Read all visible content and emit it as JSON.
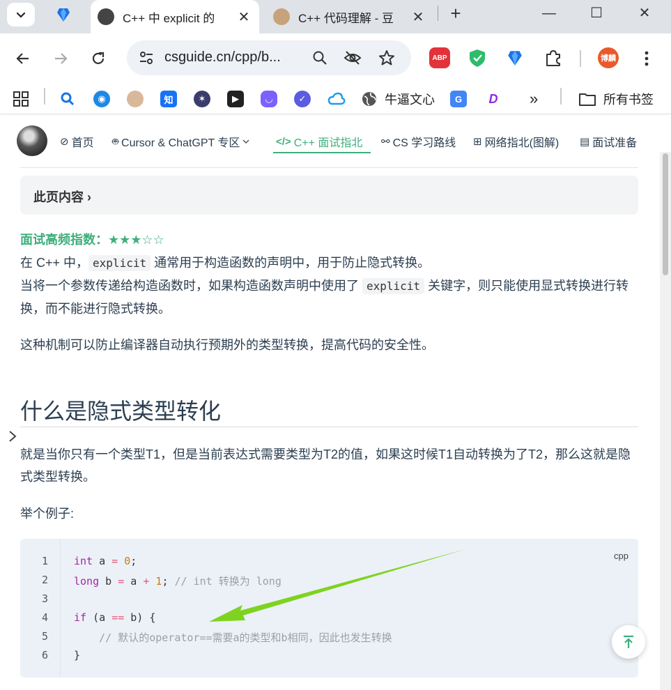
{
  "browser": {
    "tabs": [
      {
        "title": "C++ 中 explicit 的",
        "close": "✕"
      },
      {
        "title": "C++ 代码理解 - 豆",
        "close": "✕"
      }
    ],
    "new_tab": "+",
    "window_controls": {
      "minimize": "—",
      "maximize": "☐",
      "close": "✕"
    },
    "url": "csguide.cn/cpp/b...",
    "user_avatar": "博麟",
    "abp_label": "ABP",
    "bookmarks": [
      {
        "label": "牛逼文心"
      },
      {
        "label": "所有书签"
      }
    ],
    "bookmark_icons": {
      "zhihu": "知"
    },
    "overflow_chevron": "»"
  },
  "site_nav": {
    "items": [
      {
        "icon": "compass-icon",
        "label": "首页"
      },
      {
        "icon": "robot-icon",
        "label": "Cursor & ChatGPT 专区"
      },
      {
        "icon": "code-icon",
        "label": "C++ 面试指北"
      },
      {
        "icon": "route-icon",
        "label": "CS 学习路线"
      },
      {
        "icon": "network-icon",
        "label": "网络指北(图解)"
      },
      {
        "icon": "document-icon",
        "label": "面试准备"
      }
    ],
    "active_index": 2
  },
  "page": {
    "toc_label": "此页内容 ›",
    "frequency_label": "面试高频指数：",
    "frequency_stars": "★★★☆☆",
    "p1_prefix": "在 C++ 中，",
    "p1_code": "explicit",
    "p1_suffix": " 通常用于构造函数的声明中，用于防止隐式转换。",
    "p2_prefix": "当将一个参数传递给构造函数时，如果构造函数声明中使用了 ",
    "p2_code": "explicit",
    "p2_suffix": " 关键字，则只能使用显式转换进行转换，而不能进行隐式转换。",
    "p3": "这种机制可以防止编译器自动执行预期外的类型转换，提高代码的安全性。",
    "h2": "什么是隐式类型转化",
    "p4": "就是当你只有一个类型T1，但是当前表达式需要类型为T2的值，如果这时候T1自动转换为了T2，那么这就是隐式类型转换。",
    "p5": "举个例子:",
    "code_lang": "cpp",
    "code_lines": [
      {
        "n": "1"
      },
      {
        "n": "2"
      },
      {
        "n": "3"
      },
      {
        "n": "4"
      },
      {
        "n": "5"
      },
      {
        "n": "6"
      }
    ],
    "code": {
      "l1_kw": "int",
      "l1_a": " a ",
      "l1_op": "=",
      "l1_sp": " ",
      "l1_num": "0",
      "l1_end": ";",
      "l2_kw": "long",
      "l2_b": " b ",
      "l2_op1": "=",
      "l2_a": " a ",
      "l2_op2": "+",
      "l2_sp": " ",
      "l2_num": "1",
      "l2_semi": ";",
      "l2_comment": " // int 转换为 long",
      "l4_kw": "if",
      "l4_rest1": " (a ",
      "l4_op": "==",
      "l4_rest2": " b) {",
      "l5_comment": "    // 默认的operator==需要a的类型和b相同，因此也发生转换",
      "l6": "}"
    }
  },
  "colors": {
    "accent": "#3eaf7c",
    "annotation_arrow": "#7ed321"
  }
}
